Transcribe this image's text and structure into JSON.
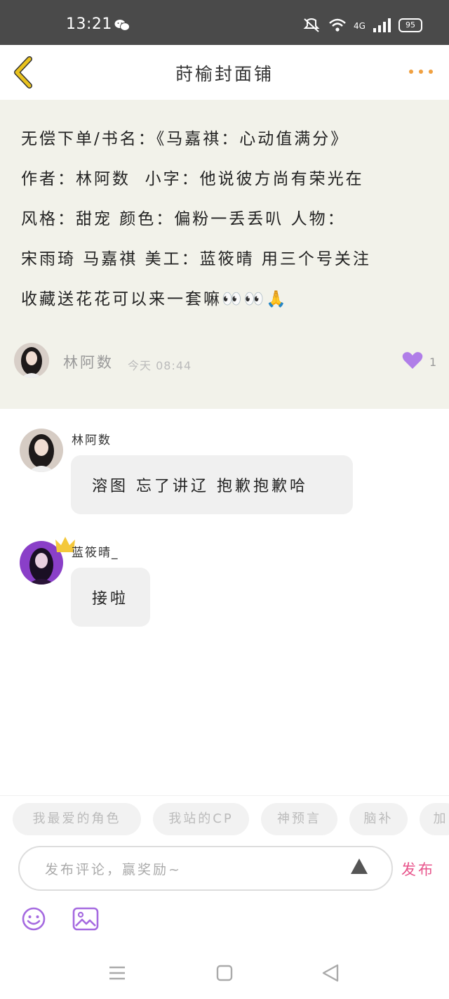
{
  "status_bar": {
    "time": "13:21",
    "battery": "95",
    "icons": [
      "wechat-icon",
      "mute-icon",
      "wifi-icon",
      "volte-icon",
      "signal-icon",
      "battery-icon"
    ]
  },
  "header": {
    "title": "莳榆封面铺",
    "back_icon": "chevron-left-icon",
    "more_icon": "more-dots-icon"
  },
  "post": {
    "content": "无偿下单/书名：《马嘉祺：心动值满分》\n作者：林阿数  小字：他说彼方尚有荣光在\n风格：甜宠 颜色：偏粉一丢丢叭 人物：\n宋雨琦 马嘉祺 美工：蓝筱晴 用三个号关注\n收藏送花花可以来一套嘛👀👀🙏",
    "author": "林阿数",
    "time": "今天 08:44",
    "likes": "1"
  },
  "comments": [
    {
      "name": "林阿数",
      "text": "溶图 忘了讲辽 抱歉抱歉哈"
    },
    {
      "name": "蓝筱晴_",
      "text": "接啦"
    }
  ],
  "tags": [
    "我最爱的角色",
    "我站的CP",
    "神预言",
    "脑补",
    "加"
  ],
  "input": {
    "placeholder": "发布评论，赢奖励~",
    "publish_label": "发布"
  },
  "colors": {
    "accent_orange": "#f0a040",
    "back_arrow": "#e9c21e",
    "heart": "#b07ee8",
    "publish": "#e8558c",
    "post_bg": "#f2f2ea",
    "tool_icon": "#a56ae0"
  }
}
